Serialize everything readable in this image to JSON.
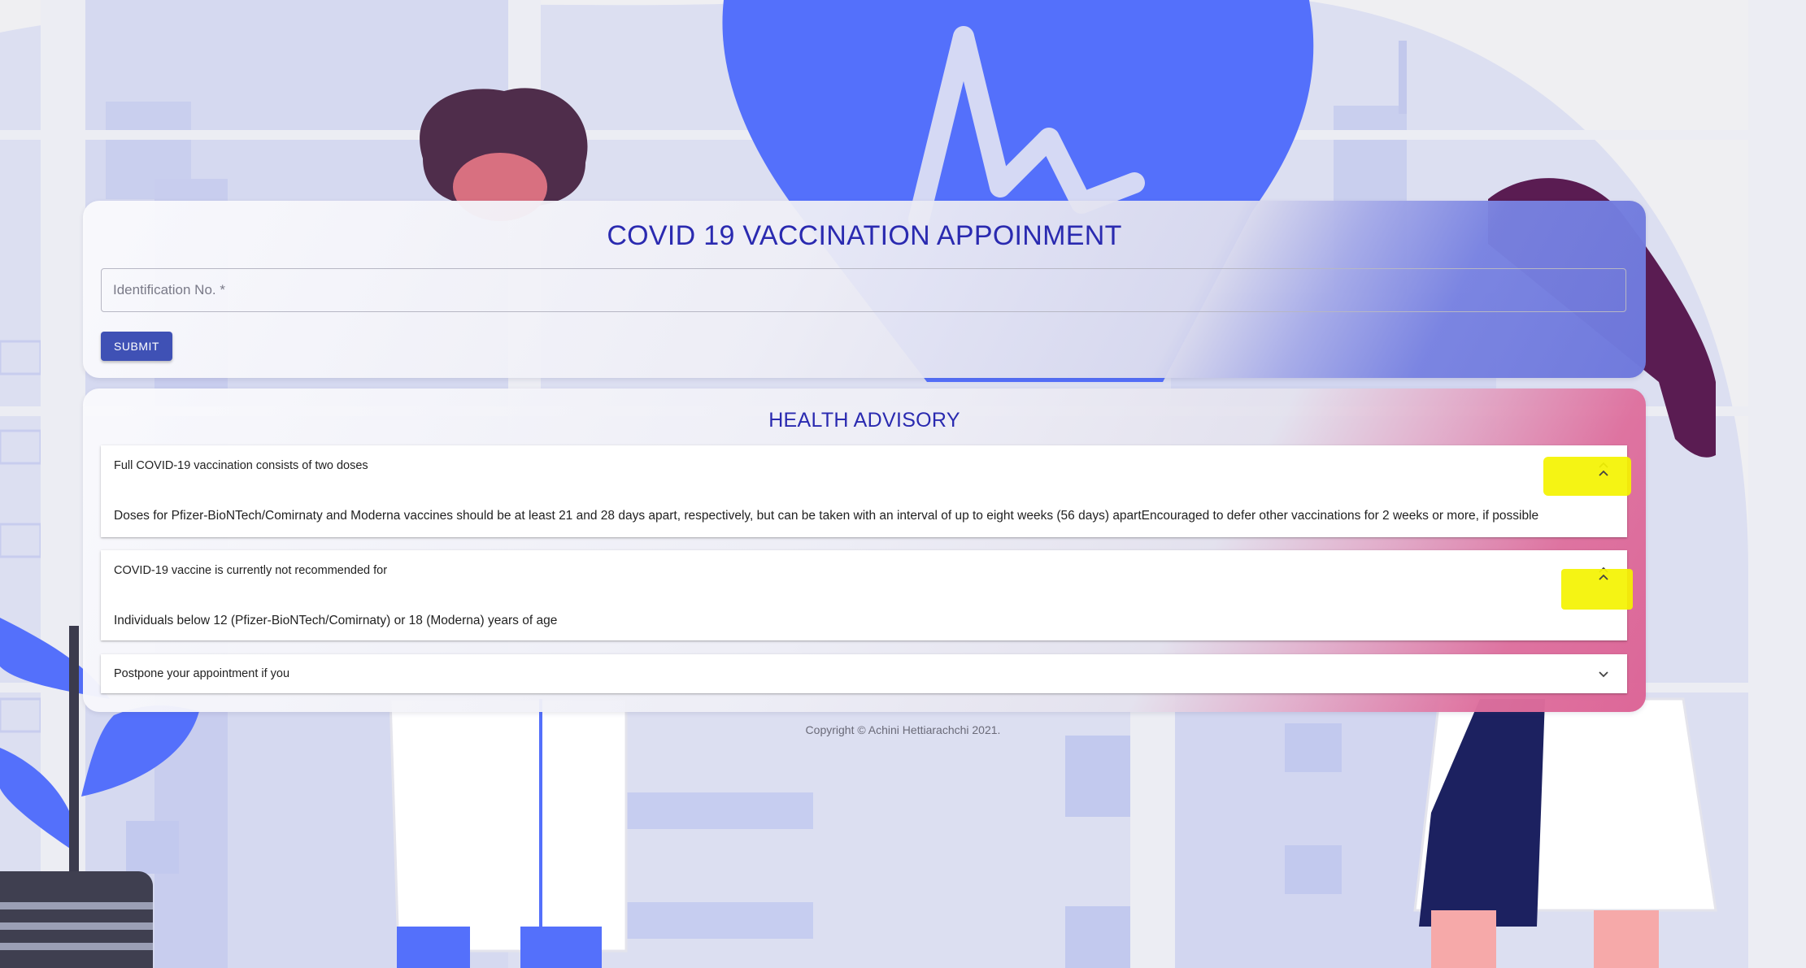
{
  "form": {
    "title": "COVID 19 VACCINATION APPOINMENT",
    "id_placeholder": "Identification No. *",
    "id_value": "",
    "submit_label": "SUBMIT"
  },
  "advisory": {
    "title": "HEALTH ADVISORY",
    "items": [
      {
        "header": "Full COVID-19 vaccination consists of two doses",
        "body": "Doses for Pfizer-BioNTech/Comirnaty and Moderna vaccines should be at least 21 and 28 days apart, respectively, but can be taken with an interval of up to eight weeks (56 days) apartEncouraged to defer other vaccinations for 2 weeks or more, if possible",
        "expanded": true,
        "chevron_icon": "chevron-up-icon"
      },
      {
        "header": "COVID-19 vaccine is currently not recommended for",
        "body": "Individuals below 12 (Pfizer-BioNTech/Comirnaty) or 18 (Moderna) years of age",
        "expanded": true,
        "chevron_icon": "chevron-up-icon"
      },
      {
        "header": "Postpone your appointment if you",
        "body": "",
        "expanded": false,
        "chevron_icon": "chevron-down-icon"
      }
    ]
  },
  "footer": {
    "copyright": "Copyright © Achini Hettiarachchi 2021."
  },
  "colors": {
    "accent": "#3f51b5",
    "title": "#2a2ab0",
    "illustration_blue": "#5470fb",
    "highlight": "#f4f300",
    "pink": "#e06b9b"
  }
}
